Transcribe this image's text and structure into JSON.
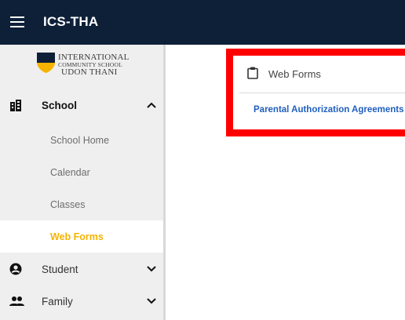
{
  "header": {
    "app_title": "ICS-THA"
  },
  "logo": {
    "line1": "INTERNATIONAL",
    "line2": "COMMUNITY SCHOOL",
    "line3": "UDON THANI"
  },
  "sidebar": {
    "school": {
      "label": "School",
      "expanded": true
    },
    "sub_items": [
      {
        "label": "School Home",
        "active": false
      },
      {
        "label": "Calendar",
        "active": false
      },
      {
        "label": "Classes",
        "active": false
      },
      {
        "label": "Web Forms",
        "active": true
      }
    ],
    "student": {
      "label": "Student",
      "expanded": false
    },
    "family": {
      "label": "Family",
      "expanded": false
    }
  },
  "card": {
    "title": "Web Forms",
    "link": "Parental Authorization Agreements"
  },
  "colors": {
    "topbar": "#0d2038",
    "active_item": "#f5b400",
    "link": "#1f5fbf",
    "highlight": "#ff0000"
  }
}
